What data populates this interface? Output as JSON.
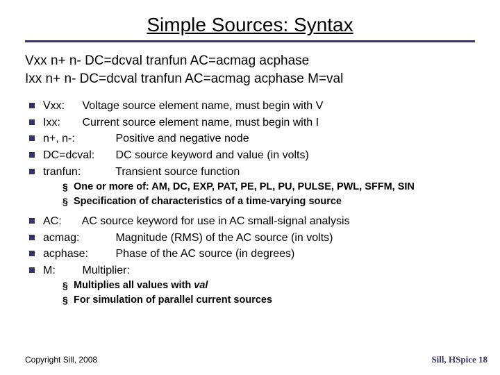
{
  "title": "Simple Sources: Syntax",
  "syntax": {
    "line1": "Vxx n+ n- DC=dcval tranfun AC=acmag acphase",
    "line2": "Ixx n+ n- DC=dcval tranfun AC=acmag acphase M=val"
  },
  "items_a": [
    {
      "term": "Vxx:",
      "desc": "Voltage source element name, must begin with V"
    },
    {
      "term": "Ixx:",
      "desc": "Current source element name, must begin with I"
    },
    {
      "term": "n+, n-:",
      "desc": "Positive and negative node"
    },
    {
      "term": "DC=dcval:",
      "desc": "DC source keyword and value (in volts)"
    },
    {
      "term": "tranfun:",
      "desc": "Transient source function"
    }
  ],
  "sub_a": [
    "One or more of: AM, DC, EXP, PAT, PE, PL, PU, PULSE, PWL, SFFM, SIN",
    "Specification of characteristics of a time-varying source"
  ],
  "items_b": [
    {
      "term": "AC:",
      "desc": "AC source keyword for use in AC small-signal analysis"
    },
    {
      "term": "acmag:",
      "desc": "Magnitude (RMS) of the AC source (in volts)"
    },
    {
      "term": "acphase:",
      "desc": "Phase of the AC source (in degrees)"
    },
    {
      "term": "M:",
      "desc": "Multiplier:"
    }
  ],
  "sub_b_pre": "Multiplies all values with ",
  "sub_b_em": "val",
  "sub_b_2": "For simulation of parallel current sources",
  "footer": {
    "left": "Copyright Sill, 2008",
    "right_label": "Sill, HSpice",
    "page": "18"
  }
}
